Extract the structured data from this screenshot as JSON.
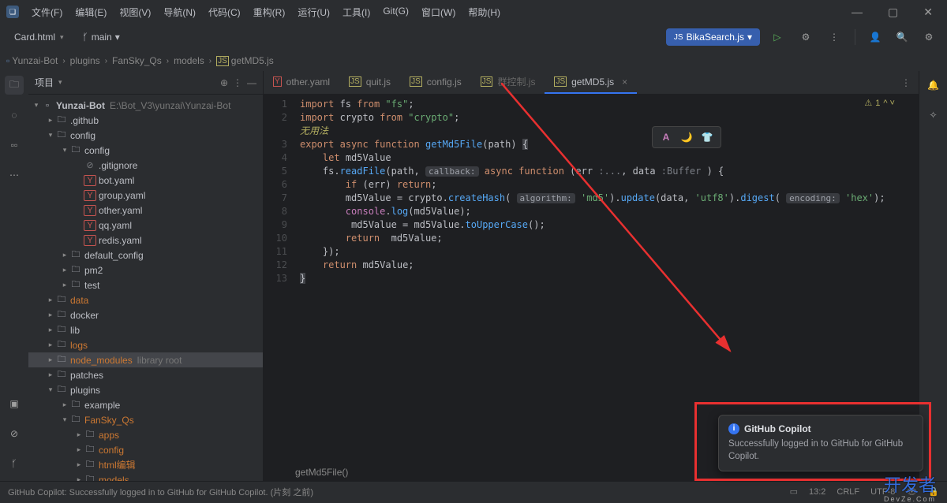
{
  "menu": [
    "文件(F)",
    "编辑(E)",
    "视图(V)",
    "导航(N)",
    "代码(C)",
    "重构(R)",
    "运行(U)",
    "工具(I)",
    "Git(G)",
    "窗口(W)",
    "帮助(H)"
  ],
  "toolbar": {
    "file": "Card.html",
    "branch": "main",
    "run_config": "BikaSearch.js"
  },
  "breadcrumb": [
    "Yunzai-Bot",
    "plugins",
    "FanSky_Qs",
    "models",
    "getMD5.js"
  ],
  "panel": {
    "title": "项目"
  },
  "tree": {
    "root": "Yunzai-Bot",
    "root_path": "E:\\Bot_V3\\yunzai\\Yunzai-Bot",
    "items": [
      {
        "d": 1,
        "t": "folder",
        "n": ".github",
        "o": false
      },
      {
        "d": 1,
        "t": "folder",
        "n": "config",
        "o": true
      },
      {
        "d": 2,
        "t": "folder",
        "n": "config",
        "o": true
      },
      {
        "d": 3,
        "t": "gitignore",
        "n": ".gitignore"
      },
      {
        "d": 3,
        "t": "yaml",
        "n": "bot.yaml"
      },
      {
        "d": 3,
        "t": "yaml",
        "n": "group.yaml"
      },
      {
        "d": 3,
        "t": "yaml",
        "n": "other.yaml"
      },
      {
        "d": 3,
        "t": "yaml",
        "n": "qq.yaml"
      },
      {
        "d": 3,
        "t": "yaml",
        "n": "redis.yaml"
      },
      {
        "d": 2,
        "t": "folder",
        "n": "default_config",
        "o": false
      },
      {
        "d": 2,
        "t": "folder",
        "n": "pm2",
        "o": false
      },
      {
        "d": 2,
        "t": "folder",
        "n": "test",
        "o": false
      },
      {
        "d": 1,
        "t": "folder",
        "n": "data",
        "o": false,
        "hl": true
      },
      {
        "d": 1,
        "t": "folder",
        "n": "docker",
        "o": false
      },
      {
        "d": 1,
        "t": "folder",
        "n": "lib",
        "o": false
      },
      {
        "d": 1,
        "t": "folder",
        "n": "logs",
        "o": false,
        "hl": true
      },
      {
        "d": 1,
        "t": "folder",
        "n": "node_modules",
        "o": false,
        "hl": true,
        "suf": "library root",
        "sel": true
      },
      {
        "d": 1,
        "t": "folder",
        "n": "patches",
        "o": false
      },
      {
        "d": 1,
        "t": "folder",
        "n": "plugins",
        "o": true
      },
      {
        "d": 2,
        "t": "folder",
        "n": "example",
        "o": false
      },
      {
        "d": 2,
        "t": "folder",
        "n": "FanSky_Qs",
        "o": true,
        "hl": true
      },
      {
        "d": 3,
        "t": "folder",
        "n": "apps",
        "o": false,
        "hl": true
      },
      {
        "d": 3,
        "t": "folder",
        "n": "config",
        "o": false,
        "hl": true
      },
      {
        "d": 3,
        "t": "folder",
        "n": "html编辑",
        "o": false,
        "hl": true
      },
      {
        "d": 3,
        "t": "folder",
        "n": "models",
        "o": false,
        "hl": true
      }
    ]
  },
  "tabs": [
    {
      "name": "other.yaml",
      "ic": "yaml"
    },
    {
      "name": "quit.js",
      "ic": "js"
    },
    {
      "name": "config.js",
      "ic": "js"
    },
    {
      "name": "群控制.js",
      "ic": "js",
      "muted": true
    },
    {
      "name": "getMD5.js",
      "ic": "js",
      "active": true
    }
  ],
  "code": {
    "fn": "getMd5File()",
    "lines": 13,
    "annot": "无用法"
  },
  "warn": {
    "count": 1
  },
  "notification": {
    "title": "GitHub Copilot",
    "body": "Successfully logged in to GitHub for GitHub Copilot."
  },
  "status": {
    "msg": "GitHub Copilot: Successfully logged in to GitHub for GitHub Copilot. (片刻 之前)",
    "pos": "13:2",
    "eol": "CRLF",
    "enc": "UTF-8"
  },
  "watermark": "开发者",
  "watermark_sub": "DevZe.Com"
}
